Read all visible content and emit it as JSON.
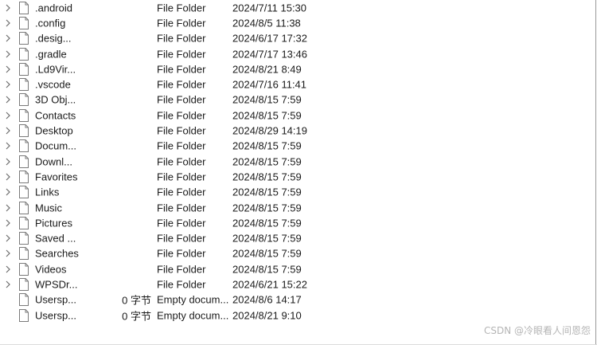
{
  "rows": [
    {
      "name": ".android",
      "size": "",
      "type": "File Folder",
      "date": "2024/7/11 15:30",
      "expandable": true
    },
    {
      "name": ".config",
      "size": "",
      "type": "File Folder",
      "date": "2024/8/5 11:38",
      "expandable": true
    },
    {
      "name": ".desig...",
      "size": "",
      "type": "File Folder",
      "date": "2024/6/17 17:32",
      "expandable": true
    },
    {
      "name": ".gradle",
      "size": "",
      "type": "File Folder",
      "date": "2024/7/17 13:46",
      "expandable": true
    },
    {
      "name": ".Ld9Vir...",
      "size": "",
      "type": "File Folder",
      "date": "2024/8/21 8:49",
      "expandable": true
    },
    {
      "name": ".vscode",
      "size": "",
      "type": "File Folder",
      "date": "2024/7/16 11:41",
      "expandable": true
    },
    {
      "name": "3D Obj...",
      "size": "",
      "type": "File Folder",
      "date": "2024/8/15 7:59",
      "expandable": true
    },
    {
      "name": "Contacts",
      "size": "",
      "type": "File Folder",
      "date": "2024/8/15 7:59",
      "expandable": true
    },
    {
      "name": "Desktop",
      "size": "",
      "type": "File Folder",
      "date": "2024/8/29 14:19",
      "expandable": true
    },
    {
      "name": "Docum...",
      "size": "",
      "type": "File Folder",
      "date": "2024/8/15 7:59",
      "expandable": true
    },
    {
      "name": "Downl...",
      "size": "",
      "type": "File Folder",
      "date": "2024/8/15 7:59",
      "expandable": true
    },
    {
      "name": "Favorites",
      "size": "",
      "type": "File Folder",
      "date": "2024/8/15 7:59",
      "expandable": true
    },
    {
      "name": "Links",
      "size": "",
      "type": "File Folder",
      "date": "2024/8/15 7:59",
      "expandable": true
    },
    {
      "name": "Music",
      "size": "",
      "type": "File Folder",
      "date": "2024/8/15 7:59",
      "expandable": true
    },
    {
      "name": "Pictures",
      "size": "",
      "type": "File Folder",
      "date": "2024/8/15 7:59",
      "expandable": true
    },
    {
      "name": "Saved ...",
      "size": "",
      "type": "File Folder",
      "date": "2024/8/15 7:59",
      "expandable": true
    },
    {
      "name": "Searches",
      "size": "",
      "type": "File Folder",
      "date": "2024/8/15 7:59",
      "expandable": true
    },
    {
      "name": "Videos",
      "size": "",
      "type": "File Folder",
      "date": "2024/8/15 7:59",
      "expandable": true
    },
    {
      "name": "WPSDr...",
      "size": "",
      "type": "File Folder",
      "date": "2024/6/21 15:22",
      "expandable": true
    },
    {
      "name": "Usersp...",
      "size": "0 字节",
      "type": "Empty docum...",
      "date": "2024/8/6 14:17",
      "expandable": false
    },
    {
      "name": "Usersp...",
      "size": "0 字节",
      "type": "Empty docum...",
      "date": "2024/8/21 9:10",
      "expandable": false
    }
  ],
  "icons": {
    "expander": "chevron-right-icon",
    "item": "document-icon"
  },
  "watermark": "CSDN @冷眼看人间恩怨",
  "colors": {
    "text": "#1a1a1a",
    "chevron": "#6b6b6b",
    "icon_stroke": "#7a7a7a",
    "watermark": "#b5b5b5"
  }
}
